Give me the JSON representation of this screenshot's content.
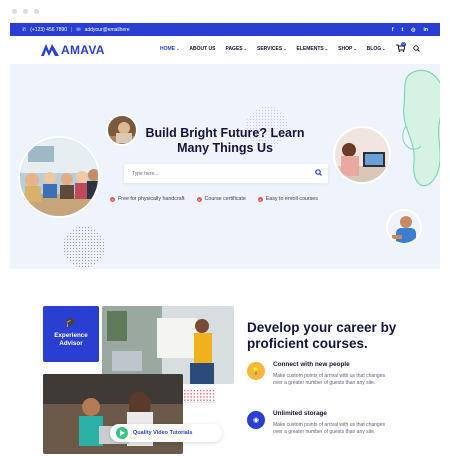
{
  "topbar": {
    "phone": "(+123) 456 7890",
    "email": "addyour@emailhere",
    "social_icons": [
      "facebook-icon",
      "twitter-icon",
      "instagram-icon",
      "linkedin-icon"
    ],
    "social_glyphs": [
      "f",
      "t",
      "◎",
      "in"
    ]
  },
  "brand": {
    "name": "AMAVA"
  },
  "nav": {
    "items": [
      "HOME",
      "ABOUT US",
      "PAGES",
      "SERVICES",
      "ELEMENTS",
      "SHOP",
      "BLOG"
    ],
    "cart_count": "0"
  },
  "hero": {
    "title_line1": "Build Bright Future? Learn",
    "title_line2": "Many Things Us",
    "search_placeholder": "Type here...",
    "features": [
      "Free for physically handcraft",
      "Course certificate",
      "Easy to enroll courses"
    ]
  },
  "about": {
    "badge_label_1": "Experience",
    "badge_label_2": "Advisor",
    "video_label": "Quality Video Tutorials",
    "title_line1": "Develop your career by",
    "title_line2": "proficient courses.",
    "features": [
      {
        "title": "Connect with new people",
        "desc": "Make custom points of arrival with us that changes over a greater number of guests than any site."
      },
      {
        "title": "Unlimited storage",
        "desc": "Make custom points of arrival with us that changes over a greater number of guests than any site."
      }
    ]
  },
  "colors": {
    "primary": "#2a3fd1",
    "accent_orange": "#f6b73c",
    "accent_red": "#e85a4f",
    "accent_green": "#37c383",
    "hero_bg": "#eef3fc"
  }
}
